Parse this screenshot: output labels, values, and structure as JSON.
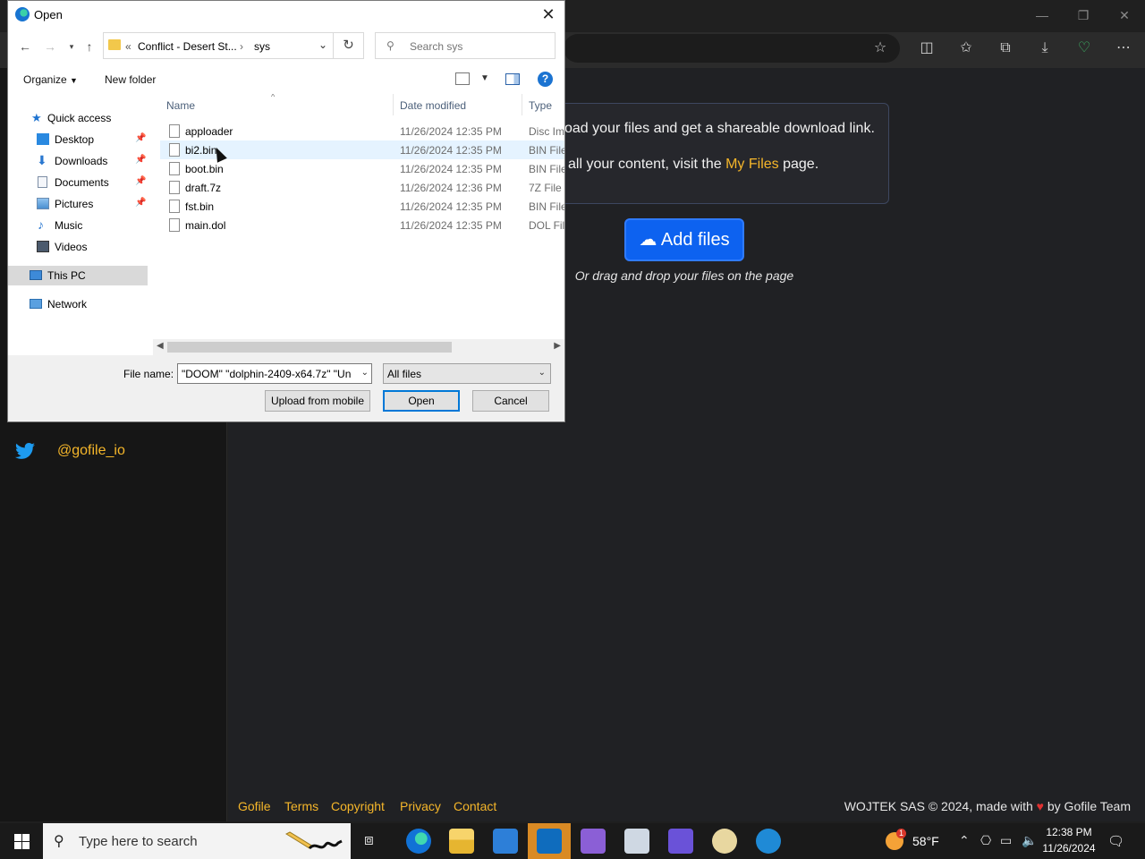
{
  "browser": {
    "window_controls": {
      "minimize": "—",
      "restore": "❐",
      "close": "✕"
    },
    "toolbar_icons": [
      "favorite-star-icon",
      "split-screen-icon",
      "favorites-icon",
      "collections-icon",
      "download-icon",
      "browser-essentials-icon",
      "more-menu-icon"
    ]
  },
  "page": {
    "info_line1_suffix": "oad your files and get a shareable download link.",
    "info_line2_prefix": "all your content, visit the ",
    "info_line2_link": "My Files",
    "info_line2_suffix": " page.",
    "add_files_label": "Add files",
    "drag_hint": "Or drag and drop your files on the page",
    "twitter_handle": "@gofile_io",
    "footer_links": [
      "Gofile",
      "Terms",
      "Copyright",
      "Privacy",
      "Contact"
    ],
    "footer_credit_before": "WOJTEK SAS © 2024, made with",
    "footer_credit_after": "by Gofile Team",
    "colors": {
      "accent": "#f5b62a",
      "button": "#0d62f0",
      "heart": "#e03131"
    }
  },
  "dialog": {
    "title": "Open",
    "path": {
      "prefix": "«",
      "crumbs": [
        "Conflict - Desert St...",
        "sys"
      ],
      "separator": "›"
    },
    "search_placeholder": "Search sys",
    "toolbar": {
      "organize": "Organize",
      "new_folder": "New folder",
      "help": "?"
    },
    "nav_items": [
      {
        "label": "Quick access",
        "pinned": false
      },
      {
        "label": "Desktop",
        "pinned": true
      },
      {
        "label": "Downloads",
        "pinned": true
      },
      {
        "label": "Documents",
        "pinned": true
      },
      {
        "label": "Pictures",
        "pinned": true
      },
      {
        "label": "Music",
        "pinned": false
      },
      {
        "label": "Videos",
        "pinned": false
      },
      {
        "label": "This PC",
        "pinned": false,
        "selected": true
      },
      {
        "label": "Network",
        "pinned": false
      }
    ],
    "columns": [
      "Name",
      "Date modified",
      "Type"
    ],
    "files": [
      {
        "name": "apploader",
        "date": "11/26/2024 12:35 PM",
        "type": "Disc Im"
      },
      {
        "name": "bi2.bin",
        "date": "11/26/2024 12:35 PM",
        "type": "BIN File",
        "hovered": true
      },
      {
        "name": "boot.bin",
        "date": "11/26/2024 12:35 PM",
        "type": "BIN File"
      },
      {
        "name": "draft.7z",
        "date": "11/26/2024 12:36 PM",
        "type": "7Z File"
      },
      {
        "name": "fst.bin",
        "date": "11/26/2024 12:35 PM",
        "type": "BIN File"
      },
      {
        "name": "main.dol",
        "date": "11/26/2024 12:35 PM",
        "type": "DOL File"
      }
    ],
    "file_name_label": "File name:",
    "file_name_value": "\"DOOM\" \"dolphin-2409-x64.7z\" \"Unc",
    "filter_value": "All files",
    "buttons": {
      "upload_mobile": "Upload from mobile",
      "open": "Open",
      "cancel": "Cancel"
    }
  },
  "taskbar": {
    "search_placeholder": "Type here to search",
    "apps": [
      "task-view-icon",
      "edge-icon",
      "file-explorer-icon",
      "store-icon",
      "mail-icon",
      "visual-studio-icon",
      "notepad-icon",
      "app-icon",
      "paint-icon",
      "dolphin-icon"
    ],
    "temperature": "58°F",
    "time": "12:38 PM",
    "date": "11/26/2024",
    "weather_badge": "1"
  }
}
